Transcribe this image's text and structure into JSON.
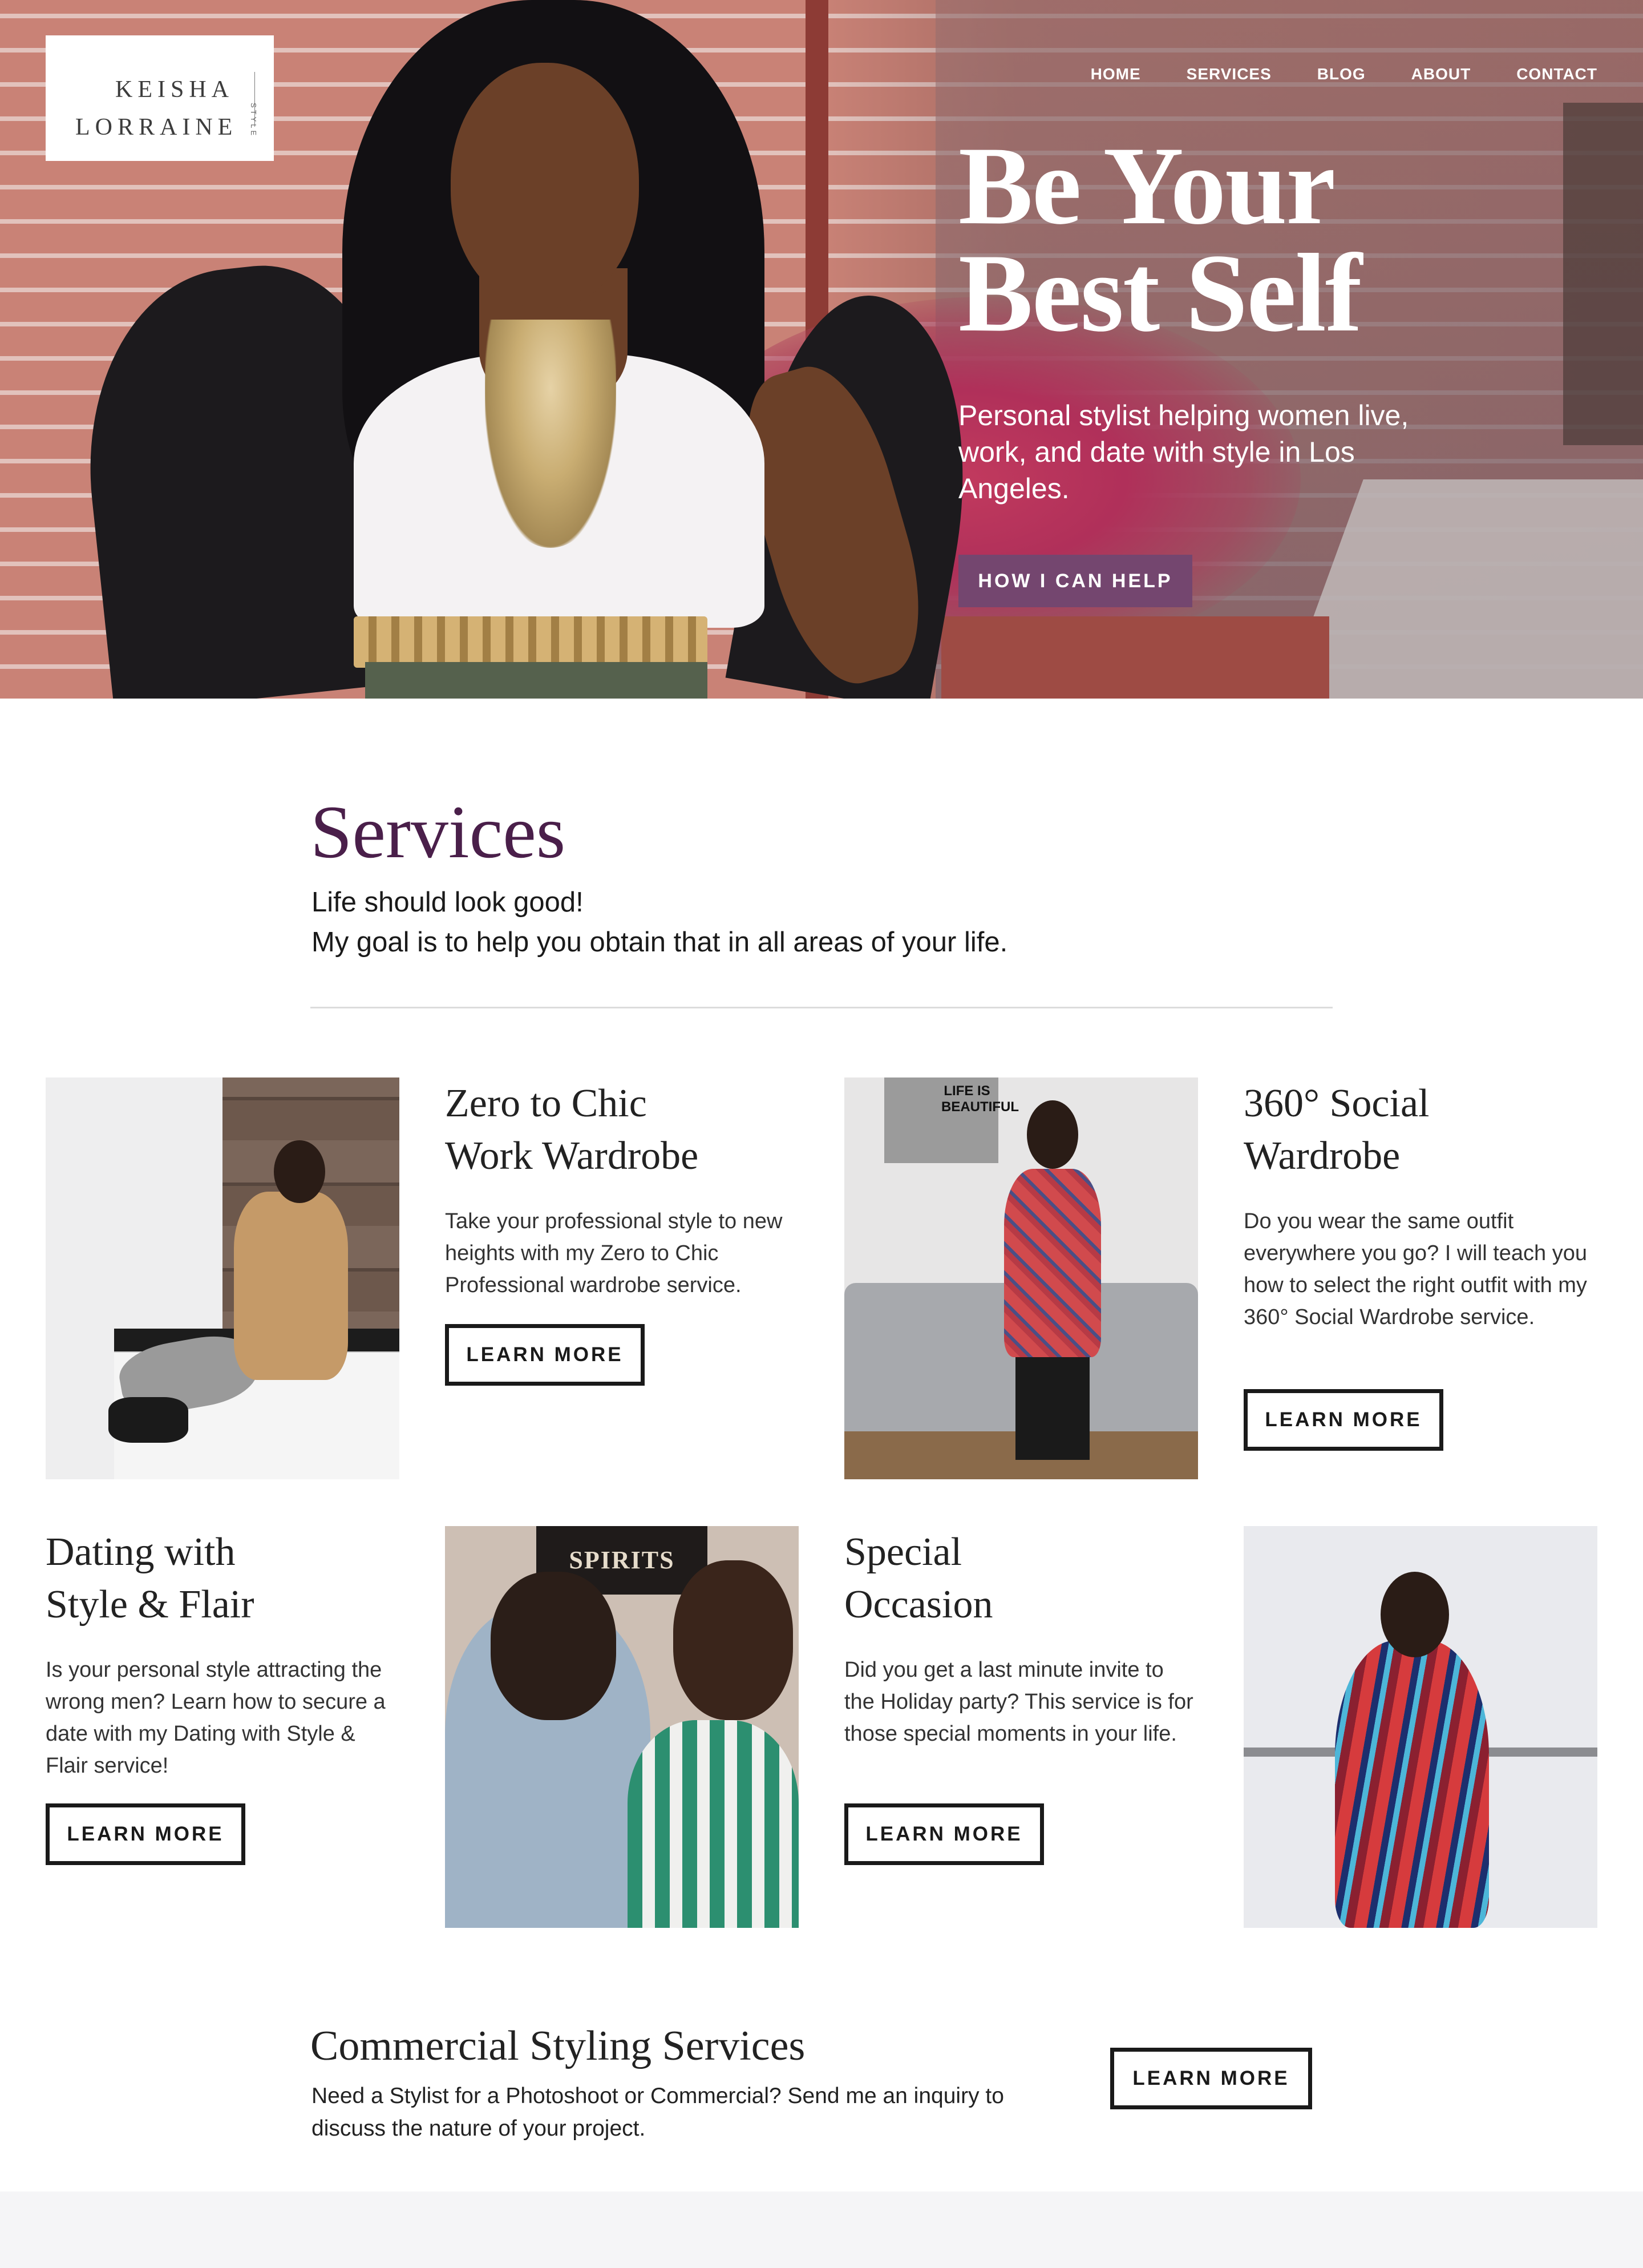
{
  "brand": {
    "name_line1": "KEISHA",
    "name_line2": "LORRAINE",
    "tag": "STYLE"
  },
  "nav": {
    "items": [
      "HOME",
      "SERVICES",
      "BLOG",
      "ABOUT",
      "CONTACT"
    ]
  },
  "hero": {
    "title_line1": "Be Your",
    "title_line2": "Best Self",
    "subtitle": "Personal stylist helping women live, work, and date with style in Los Angeles.",
    "cta_label": "HOW I CAN HELP",
    "cta_color": "#74466f"
  },
  "services": {
    "title": "Services",
    "tagline_line1": "Life should look good!",
    "tagline_line2": "My goal is to help you obtain that in all areas of your life.",
    "title_color": "#4a1f4a",
    "cards": [
      {
        "title_line1": "Zero to Chic",
        "title_line2": "Work Wardrobe",
        "description": "Take your professional style to new heights with my Zero to Chic Professional wardrobe service.",
        "button_label": "LEARN MORE"
      },
      {
        "title_line1": "360° Social",
        "title_line2": "Wardrobe",
        "description": "Do you wear the same outfit everywhere you go? I will teach you how to select the right outfit with my 360° Social Wardrobe service.",
        "button_label": "LEARN MORE"
      },
      {
        "title_line1": "Dating with",
        "title_line2": "Style & Flair",
        "description": "Is your personal style attracting the wrong men?  Learn how to secure a date with my Dating with Style & Flair service!",
        "button_label": "LEARN MORE"
      },
      {
        "title_line1": "Special",
        "title_line2": "Occasion",
        "description": "Did you get a last minute invite to the Holiday party?  This service is for those special moments in your life.",
        "button_label": "LEARN MORE"
      }
    ]
  },
  "photos": {
    "poster_text": "LIFE IS BEAUTIFUL",
    "sign_text": "SPIRITS"
  },
  "commercial": {
    "title": "Commercial Styling Services",
    "description": "Need a Stylist for a Photoshoot or Commercial? Send me an inquiry to discuss the nature of your project.",
    "button_label": "LEARN MORE"
  }
}
